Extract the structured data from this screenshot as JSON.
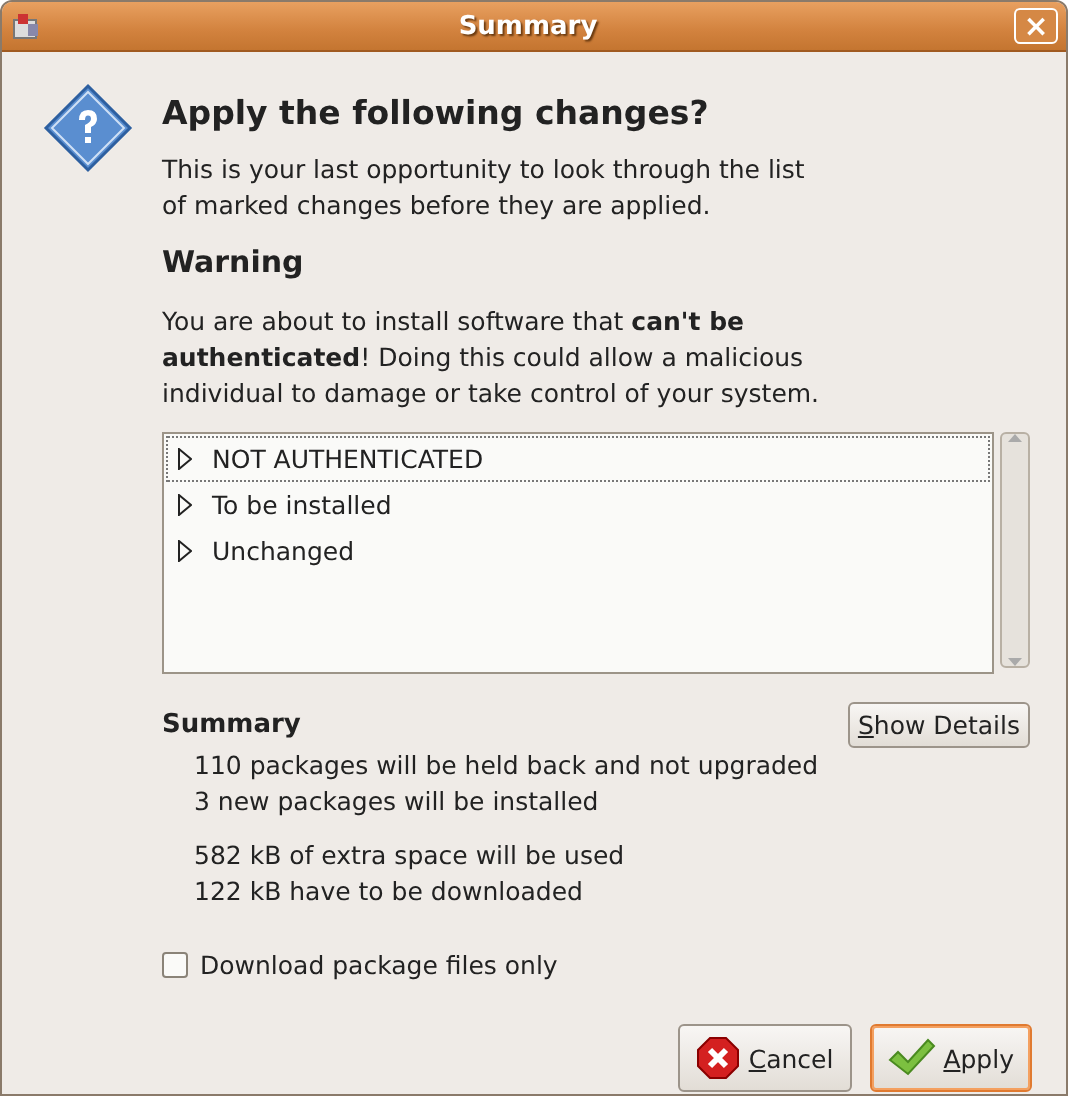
{
  "window": {
    "title": "Summary",
    "close": "×"
  },
  "heading": "Apply the following changes?",
  "intro": "This is your last opportunity to look through the list of marked changes before they are applied.",
  "warning": {
    "title": "Warning",
    "text": "You are about to install software that **can't be authenticated**! Doing this could allow a malicious individual to damage or take control of your system."
  },
  "tree": [
    {
      "label": "NOT AUTHENTICATED",
      "expanded": false,
      "selected": true
    },
    {
      "label": "To be installed",
      "expanded": false,
      "selected": false
    },
    {
      "label": "Unchanged",
      "expanded": false,
      "selected": false
    }
  ],
  "summary": {
    "title": "Summary",
    "details_button": "Show Details",
    "groups": [
      [
        "110 packages will be held back and not upgraded",
        "3 new packages will be installed"
      ],
      [
        "582 kB of extra space will be used",
        "122 kB have to be downloaded"
      ]
    ]
  },
  "download_only": {
    "label": "Download package files only",
    "checked": false
  },
  "buttons": [
    {
      "kind": "cancel",
      "label": "Cancel",
      "default": false
    },
    {
      "kind": "apply",
      "label": "Apply",
      "default": true
    }
  ]
}
